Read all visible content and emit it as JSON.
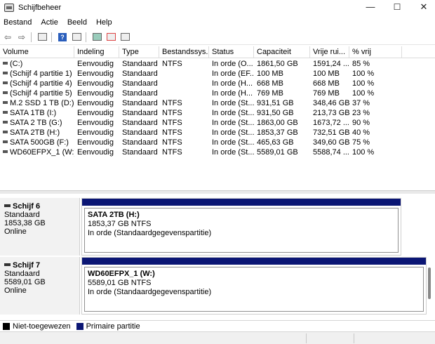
{
  "window": {
    "title": "Schijfbeheer",
    "minimize": "—",
    "maximize": "☐",
    "close": "✕"
  },
  "menu": [
    "Bestand",
    "Actie",
    "Beeld",
    "Help"
  ],
  "toolbar": {
    "back": "⇦",
    "forward": "⇨"
  },
  "columns": [
    "Volume",
    "Indeling",
    "Type",
    "Bestandssys...",
    "Status",
    "Capaciteit",
    "Vrije rui...",
    "% vrij"
  ],
  "volumes": [
    [
      "(C:)",
      "Eenvoudig",
      "Standaard",
      "NTFS",
      "In orde (O...",
      "1861,50 GB",
      "1591,24 ...",
      "85 %"
    ],
    [
      "(Schijf 4 partitie 1)",
      "Eenvoudig",
      "Standaard",
      "",
      "In orde (EF...",
      "100 MB",
      "100 MB",
      "100 %"
    ],
    [
      "(Schijf 4 partitie 4)",
      "Eenvoudig",
      "Standaard",
      "",
      "In orde (H...",
      "668 MB",
      "668 MB",
      "100 %"
    ],
    [
      "(Schijf 4 partitie 5)",
      "Eenvoudig",
      "Standaard",
      "",
      "In orde (H...",
      "769 MB",
      "769 MB",
      "100 %"
    ],
    [
      "M.2 SSD 1 TB (D:)",
      "Eenvoudig",
      "Standaard",
      "NTFS",
      "In orde (St...",
      "931,51 GB",
      "348,46 GB",
      "37 %"
    ],
    [
      "SATA 1TB (I:)",
      "Eenvoudig",
      "Standaard",
      "NTFS",
      "In orde (St...",
      "931,50 GB",
      "213,73 GB",
      "23 %"
    ],
    [
      "SATA 2 TB (G:)",
      "Eenvoudig",
      "Standaard",
      "NTFS",
      "In orde (St...",
      "1863,00 GB",
      "1673,72 ...",
      "90 %"
    ],
    [
      "SATA 2TB (H:)",
      "Eenvoudig",
      "Standaard",
      "NTFS",
      "In orde (St...",
      "1853,37 GB",
      "732,51 GB",
      "40 %"
    ],
    [
      "SATA 500GB (F:)",
      "Eenvoudig",
      "Standaard",
      "NTFS",
      "In orde (St...",
      "465,63 GB",
      "349,60 GB",
      "75 %"
    ],
    [
      "WD60EFPX_1 (W:)",
      "Eenvoudig",
      "Standaard",
      "NTFS",
      "In orde (St...",
      "5589,01 GB",
      "5588,74 ...",
      "100 %"
    ]
  ],
  "disks": [
    {
      "name": "Schijf 6",
      "type": "Standaard",
      "size": "1853,38 GB",
      "status": "Online",
      "partition": {
        "title": "SATA 2TB  (H:)",
        "size": "1853,37 GB NTFS",
        "status": "In orde (Standaardgegevenspartitie)"
      }
    },
    {
      "name": "Schijf 7",
      "type": "Standaard",
      "size": "5589,01 GB",
      "status": "Online",
      "partition": {
        "title": "WD60EFPX_1  (W:)",
        "size": "5589,01 GB NTFS",
        "status": "In orde (Standaardgegevenspartitie)"
      }
    }
  ],
  "legend": [
    {
      "label": "Niet-toegewezen",
      "color": "#000000"
    },
    {
      "label": "Primaire partitie",
      "color": "#0b1674"
    }
  ]
}
